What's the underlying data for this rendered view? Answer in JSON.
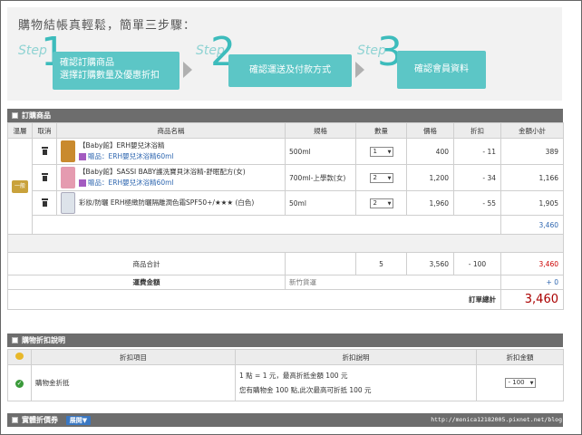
{
  "banner": {
    "title": "購物結帳真輕鬆，簡單三步驟：",
    "steps": [
      {
        "word": "Step",
        "num": "1",
        "line1": "確認訂購商品",
        "line2": "選擇訂購數量及優惠折扣"
      },
      {
        "word": "Step",
        "num": "2",
        "line1": "確認運送及付款方式",
        "line2": ""
      },
      {
        "word": "Step",
        "num": "3",
        "line1": "確認會員資料",
        "line2": ""
      }
    ]
  },
  "order": {
    "section_title": "訂購商品",
    "headers": [
      "溫層",
      "取消",
      "商品名稱",
      "規格",
      "數量",
      "價格",
      "折扣",
      "金額小計"
    ],
    "temp_badge": "一般",
    "items": [
      {
        "name": "【Baby館】ERH嬰兒沐浴精",
        "gift": "贈品：ERH嬰兒沐浴精60ml",
        "spec": "500ml",
        "qty": "1",
        "price": "400",
        "discount": "- 11",
        "subtotal": "389",
        "thumb_color": "#c98a2e"
      },
      {
        "name": "【Baby館】SASSI BABY護洗寶貝沐浴精-舒眠配方(女)",
        "gift": "贈品：ERH嬰兒沐浴精60ml",
        "spec": "700ml-上學款(女)",
        "qty": "2",
        "price": "1,200",
        "discount": "- 34",
        "subtotal": "1,166",
        "thumb_color": "#e59bb0"
      },
      {
        "name": "彩妝/防曬 ERH極緻防曬隔離潤色霜SPF50+/★★★ (白色)",
        "gift": "",
        "spec": "50ml",
        "qty": "2",
        "price": "1,960",
        "discount": "- 55",
        "subtotal": "1,905",
        "thumb_color": "#dde3ea"
      }
    ],
    "group_total": "3,460",
    "summary": {
      "label": "商品合計",
      "qty": "5",
      "price": "3,560",
      "discount": "- 100",
      "subtotal": "3,460"
    },
    "shipping": {
      "label": "運費金額",
      "note": "新竹貨運",
      "value": "+ 0"
    },
    "grand_total_label": "訂單總計",
    "grand_total": "3,460"
  },
  "discount": {
    "section_title": "購物折扣說明",
    "headers": [
      "折扣項目",
      "折扣說明",
      "折扣金額"
    ],
    "row": {
      "item": "購物金折抵",
      "desc1": "1 點 = 1 元，最高折抵金額 100 元",
      "desc2": "您有購物金 100 點,此次最高可折抵 100 元",
      "amount": "- 100"
    }
  },
  "coupon": {
    "section_title": "實體折價券",
    "expand_label": "展開▼",
    "watermark": "http://monica12182005.pixnet.net/blog"
  },
  "colors": {
    "teal": "#5cc6c6",
    "section_bar": "#6d6d6d",
    "total_red": "#a00000"
  }
}
